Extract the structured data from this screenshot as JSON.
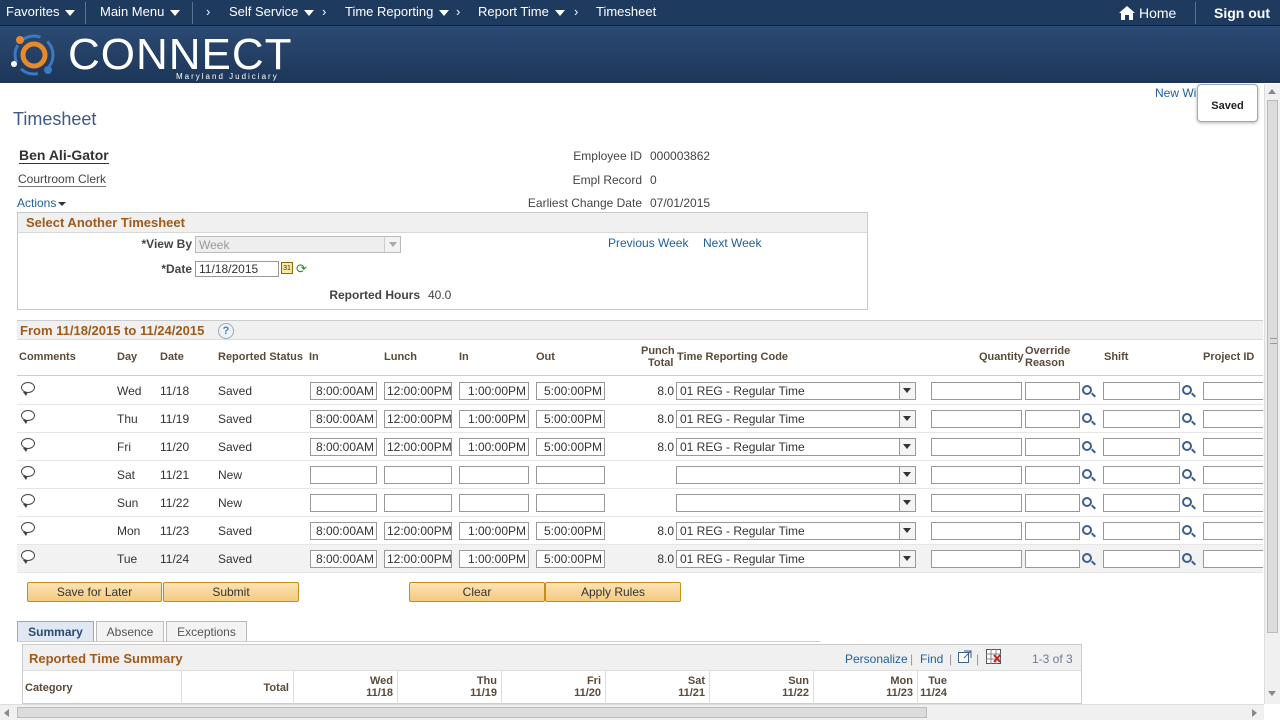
{
  "nav": {
    "favorites": "Favorites",
    "main_menu": "Main Menu",
    "crumbs": [
      "Self Service",
      "Time Reporting",
      "Report Time",
      "Timesheet"
    ],
    "home": "Home",
    "sign_out": "Sign out"
  },
  "banner": {
    "logo_text": "CONNECT",
    "logo_sub": "Maryland Judiciary"
  },
  "new_window": "New Wi",
  "saved_popup": "Saved",
  "page_title": "Timesheet",
  "employee": {
    "name": "Ben Ali-Gator",
    "title": "Courtroom Clerk",
    "actions": "Actions",
    "id_label": "Employee ID",
    "id": "000003862",
    "record_label": "Empl Record",
    "record": "0",
    "change_label": "Earliest Change Date",
    "change_date": "07/01/2015"
  },
  "select_timesheet": {
    "heading": "Select Another Timesheet",
    "view_by_label": "*View By",
    "view_by_value": "Week",
    "date_label": "*Date",
    "date_value": "11/18/2015",
    "prev_week": "Previous Week",
    "next_week": "Next Week",
    "reported_hours_label": "Reported Hours",
    "reported_hours": "40.0"
  },
  "grid": {
    "range_title": "From 11/18/2015 to 11/24/2015",
    "help": "?",
    "columns": {
      "comments": "Comments",
      "day": "Day",
      "date": "Date",
      "status": "Reported Status",
      "in": "In",
      "lunch": "Lunch",
      "in2": "In",
      "out": "Out",
      "punch_total_1": "Punch",
      "punch_total_2": "Total",
      "trc": "Time Reporting Code",
      "quantity": "Quantity",
      "override_1": "Override",
      "override_2": "Reason",
      "shift": "Shift",
      "project": "Project ID"
    },
    "rows": [
      {
        "day": "Wed",
        "date": "11/18",
        "status": "Saved",
        "in": "8:00:00AM",
        "lunch": "12:00:00PM",
        "in2": "1:00:00PM",
        "out": "5:00:00PM",
        "total": "8.0",
        "trc": "01 REG - Regular Time"
      },
      {
        "day": "Thu",
        "date": "11/19",
        "status": "Saved",
        "in": "8:00:00AM",
        "lunch": "12:00:00PM",
        "in2": "1:00:00PM",
        "out": "5:00:00PM",
        "total": "8.0",
        "trc": "01 REG - Regular Time"
      },
      {
        "day": "Fri",
        "date": "11/20",
        "status": "Saved",
        "in": "8:00:00AM",
        "lunch": "12:00:00PM",
        "in2": "1:00:00PM",
        "out": "5:00:00PM",
        "total": "8.0",
        "trc": "01 REG - Regular Time"
      },
      {
        "day": "Sat",
        "date": "11/21",
        "status": "New",
        "in": "",
        "lunch": "",
        "in2": "",
        "out": "",
        "total": "",
        "trc": ""
      },
      {
        "day": "Sun",
        "date": "11/22",
        "status": "New",
        "in": "",
        "lunch": "",
        "in2": "",
        "out": "",
        "total": "",
        "trc": ""
      },
      {
        "day": "Mon",
        "date": "11/23",
        "status": "Saved",
        "in": "8:00:00AM",
        "lunch": "12:00:00PM",
        "in2": "1:00:00PM",
        "out": "5:00:00PM",
        "total": "8.0",
        "trc": "01 REG - Regular Time"
      },
      {
        "day": "Tue",
        "date": "11/24",
        "status": "Saved",
        "in": "8:00:00AM",
        "lunch": "12:00:00PM",
        "in2": "1:00:00PM",
        "out": "5:00:00PM",
        "total": "8.0",
        "trc": "01 REG - Regular Time"
      }
    ]
  },
  "buttons": {
    "save_for_later": "Save for Later",
    "submit": "Submit",
    "clear": "Clear",
    "apply_rules": "Apply Rules"
  },
  "tabs": [
    "Summary",
    "Absence",
    "Exceptions"
  ],
  "summary": {
    "heading": "Reported Time Summary",
    "personalize": "Personalize",
    "find": "Find",
    "count": "1-3 of 3",
    "category": "Category",
    "total": "Total",
    "days": [
      {
        "d": "Wed",
        "date": "11/18"
      },
      {
        "d": "Thu",
        "date": "11/19"
      },
      {
        "d": "Fri",
        "date": "11/20"
      },
      {
        "d": "Sat",
        "date": "11/21"
      },
      {
        "d": "Sun",
        "date": "11/22"
      },
      {
        "d": "Mon",
        "date": "11/23"
      },
      {
        "d": "Tue",
        "date": "11/24"
      }
    ]
  },
  "colors": {
    "nav_bg": "#1f3a5f",
    "section_title": "#a05a1a",
    "link": "#1f5f99",
    "button_fill": "#f5ca7f"
  }
}
